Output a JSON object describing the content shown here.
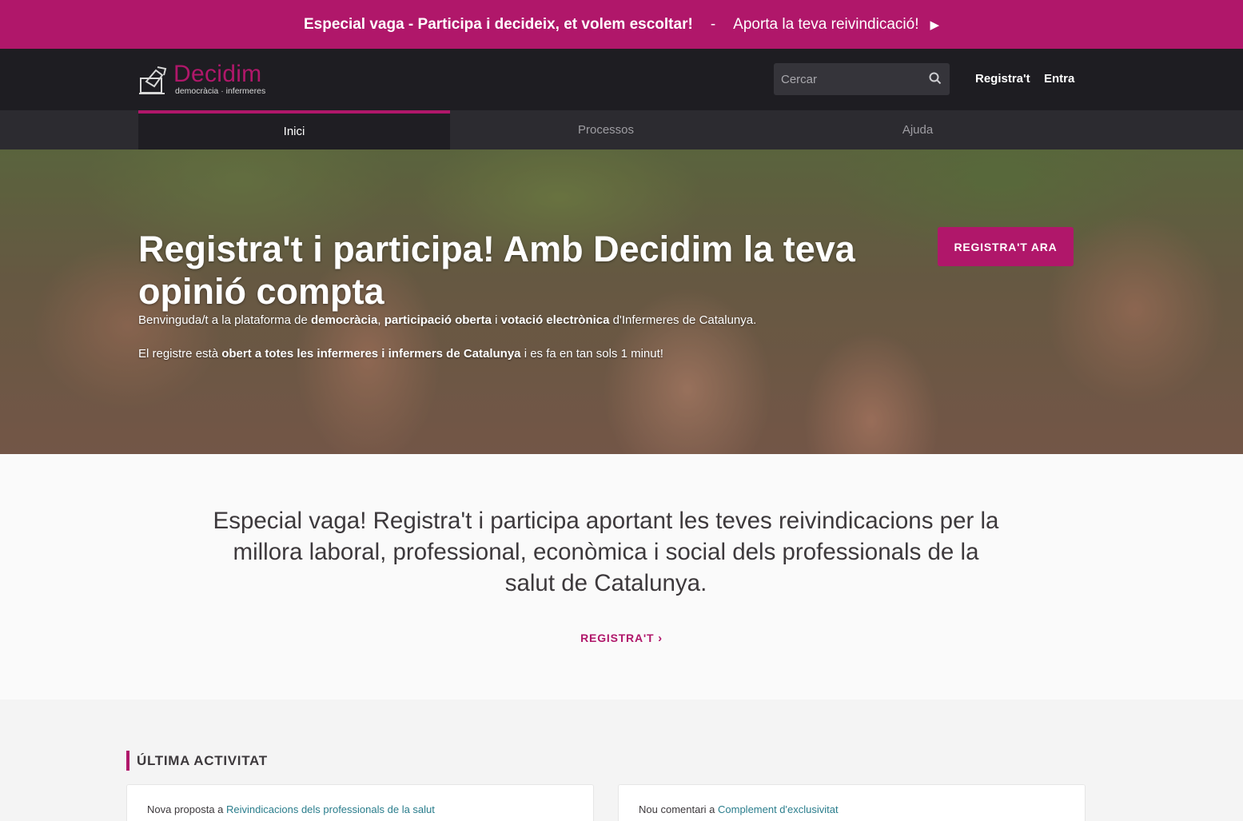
{
  "announcement": {
    "strong_text": "Especial vaga - Participa i decideix, et volem escoltar!",
    "separator": "-",
    "link_text": "Aporta la teva reivindicació!",
    "play_icon": "play-icon"
  },
  "header": {
    "logo_name": "Decidim",
    "logo_sub": "democràcia · infermeres",
    "search_placeholder": "Cercar",
    "register_link": "Registra't",
    "login_link": "Entra"
  },
  "nav": {
    "tabs": [
      {
        "label": "Inici",
        "active": true
      },
      {
        "label": "Processos",
        "active": false
      },
      {
        "label": "Ajuda",
        "active": false
      }
    ]
  },
  "hero": {
    "title": "Registra't i participa! Amb Decidim la teva opinió compta",
    "p1": [
      {
        "t": "Benvinguda/t a la plataforma de ",
        "b": false
      },
      {
        "t": "democràcia",
        "b": true
      },
      {
        "t": ", ",
        "b": false
      },
      {
        "t": "participació oberta",
        "b": true
      },
      {
        "t": " i ",
        "b": false
      },
      {
        "t": "votació electrònica",
        "b": true
      },
      {
        "t": " d'Infermeres de Catalunya.",
        "b": false
      }
    ],
    "p2": [
      {
        "t": "El registre està ",
        "b": false
      },
      {
        "t": "obert a totes les infermeres i infermers de Catalunya",
        "b": true
      },
      {
        "t": " i es fa en tan sols 1 minut!",
        "b": false
      }
    ],
    "button_label": "REGISTRA'T ARA"
  },
  "intro": {
    "text": "Especial vaga! Registra't i participa aportant les teves reivindicacions per la millora laboral, professional, econòmica i social dels professionals de la salut de Catalunya.",
    "link_label": "REGISTRA'T",
    "link_chevron": "›"
  },
  "activity": {
    "title": "ÚLTIMA ACTIVITAT",
    "cards": [
      {
        "prefix": "Nova proposta a ",
        "link": "Reivindicacions dels professionals de la salut"
      },
      {
        "prefix": "Nou comentari a ",
        "link": "Complement d'exclusivitat"
      }
    ]
  },
  "colors": {
    "brand": "#b0176a",
    "header_bg": "#1e1d22",
    "nav_bg": "#2c2b30",
    "link": "#2a7d8c"
  }
}
